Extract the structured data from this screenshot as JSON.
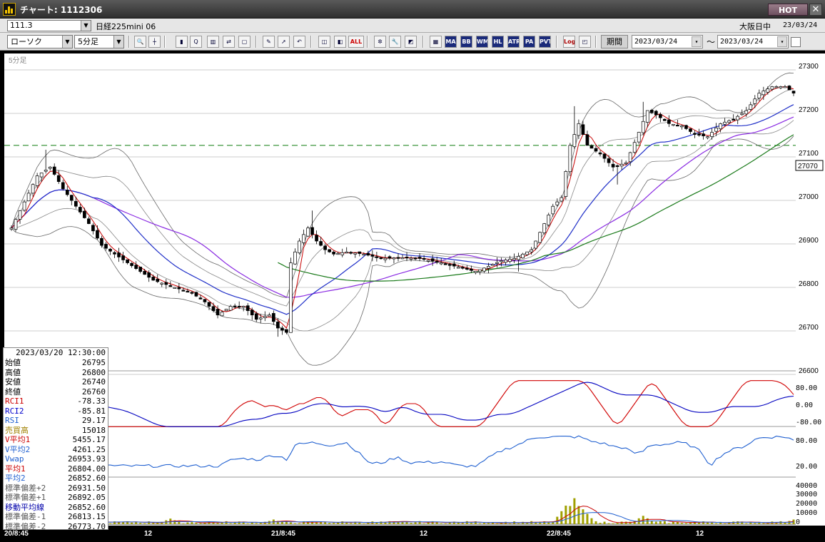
{
  "window": {
    "title": "チャート: 1112306",
    "hot_label": "HOT",
    "close_glyph": "✕"
  },
  "symbol_bar": {
    "code": "111.3",
    "symbol_name": "日経225mini 06",
    "market": "大阪日中",
    "date": "23/03/24"
  },
  "toolbar": {
    "chart_type": "ローソク",
    "timeframe": "5分足",
    "buttons": [
      "MA",
      "BB",
      "WMA",
      "HL",
      "ATR",
      "PA",
      "PVT",
      "Log",
      "ALL"
    ],
    "period_label": "期間",
    "date_from": "2023/03/24",
    "date_to": "2023/03/24",
    "tilde": "～"
  },
  "chart_label": "5分足",
  "price_axis": {
    "ticks": [
      "27300",
      "27200",
      "27100",
      "27000",
      "26900",
      "26800",
      "26700",
      "26600"
    ],
    "current": "27070"
  },
  "rci_axis": {
    "ticks": [
      "80.00",
      "0.00",
      "-80.00"
    ]
  },
  "rsi_axis": {
    "ticks": [
      "80.00",
      "20.00"
    ]
  },
  "volume_axis": {
    "ticks": [
      "40000",
      "30000",
      "20000",
      "10000",
      "0"
    ]
  },
  "x_axis": {
    "labels": [
      "20/8:45",
      "12",
      "21/8:45",
      "12",
      "22/8:45",
      "12"
    ]
  },
  "info": {
    "timestamp": "2023/03/20  12:30:00",
    "rows": [
      {
        "label": "始値",
        "value": "26795",
        "color": "#000000"
      },
      {
        "label": "高値",
        "value": "26800",
        "color": "#000000"
      },
      {
        "label": "安値",
        "value": "26740",
        "color": "#000000"
      },
      {
        "label": "終値",
        "value": "26760",
        "color": "#000000"
      },
      {
        "label": "RCI1",
        "value": "-78.33",
        "color": "#cc0000"
      },
      {
        "label": "RCI2",
        "value": "-85.81",
        "color": "#0000cc"
      },
      {
        "label": "RSI",
        "value": "29.17",
        "color": "#2060d0"
      },
      {
        "label": "売買高",
        "value": "15018",
        "color": "#a08000"
      },
      {
        "label": "V平均1",
        "value": "5455.17",
        "color": "#cc0000"
      },
      {
        "label": "V平均2",
        "value": "4261.25",
        "color": "#2060d0"
      },
      {
        "label": "Vwap",
        "value": "26953.93",
        "color": "#2060d0"
      },
      {
        "label": "平均1",
        "value": "26804.00",
        "color": "#cc0000"
      },
      {
        "label": "平均2",
        "value": "26852.60",
        "color": "#2060d0"
      },
      {
        "label": "標準偏差+2",
        "value": "26931.50",
        "color": "#555555"
      },
      {
        "label": "標準偏差+1",
        "value": "26892.05",
        "color": "#555555"
      },
      {
        "label": "移動平均線",
        "value": "26852.60",
        "color": "#0000aa"
      },
      {
        "label": "標準偏差-1",
        "value": "26813.15",
        "color": "#555555"
      },
      {
        "label": "標準偏差-2",
        "value": "26773.70",
        "color": "#555555"
      }
    ]
  },
  "chart_data": {
    "type": "candlestick",
    "timeframe": "5分足",
    "dashed_level": 27120,
    "close_path": [
      [
        0,
        26930
      ],
      [
        3,
        26990
      ],
      [
        6,
        27050
      ],
      [
        9,
        27070
      ],
      [
        12,
        27020
      ],
      [
        15,
        26980
      ],
      [
        18,
        26940
      ],
      [
        21,
        26890
      ],
      [
        24,
        26870
      ],
      [
        27,
        26850
      ],
      [
        30,
        26830
      ],
      [
        33,
        26810
      ],
      [
        36,
        26800
      ],
      [
        39,
        26790
      ],
      [
        42,
        26780
      ],
      [
        45,
        26760
      ],
      [
        48,
        26730
      ],
      [
        51,
        26750
      ],
      [
        54,
        26750
      ],
      [
        57,
        26720
      ],
      [
        60,
        26730
      ],
      [
        62,
        26700
      ],
      [
        64,
        26690
      ],
      [
        65,
        26850
      ],
      [
        67,
        26900
      ],
      [
        69,
        26930
      ],
      [
        71,
        26900
      ],
      [
        73,
        26880
      ],
      [
        75,
        26870
      ],
      [
        78,
        26875
      ],
      [
        82,
        26870
      ],
      [
        86,
        26860
      ],
      [
        90,
        26862
      ],
      [
        95,
        26860
      ],
      [
        100,
        26850
      ],
      [
        104,
        26840
      ],
      [
        108,
        26830
      ],
      [
        111,
        26842
      ],
      [
        114,
        26855
      ],
      [
        117,
        26860
      ],
      [
        121,
        26880
      ],
      [
        126,
        26980
      ],
      [
        128,
        27000
      ],
      [
        130,
        27120
      ],
      [
        132,
        27170
      ],
      [
        134,
        27120
      ],
      [
        137,
        27100
      ],
      [
        140,
        27070
      ],
      [
        143,
        27080
      ],
      [
        146,
        27150
      ],
      [
        148,
        27200
      ],
      [
        150,
        27190
      ],
      [
        153,
        27170
      ],
      [
        156,
        27165
      ],
      [
        159,
        27145
      ],
      [
        162,
        27140
      ],
      [
        165,
        27170
      ],
      [
        168,
        27180
      ],
      [
        171,
        27200
      ],
      [
        174,
        27240
      ],
      [
        177,
        27255
      ],
      [
        180,
        27255
      ],
      [
        182,
        27240
      ]
    ],
    "high_spikes": [
      [
        8,
        27110
      ],
      [
        70,
        26970
      ],
      [
        131,
        27210
      ],
      [
        147,
        27220
      ]
    ],
    "low_spikes": [
      [
        62,
        26680
      ],
      [
        65,
        26815
      ],
      [
        141,
        27030
      ],
      [
        118,
        26830
      ]
    ],
    "volume_peaks": [
      [
        37,
        6000
      ],
      [
        61,
        5000
      ],
      [
        129,
        20000
      ],
      [
        131,
        28000
      ],
      [
        133,
        16000
      ],
      [
        147,
        9000
      ],
      [
        182,
        5000
      ]
    ]
  }
}
